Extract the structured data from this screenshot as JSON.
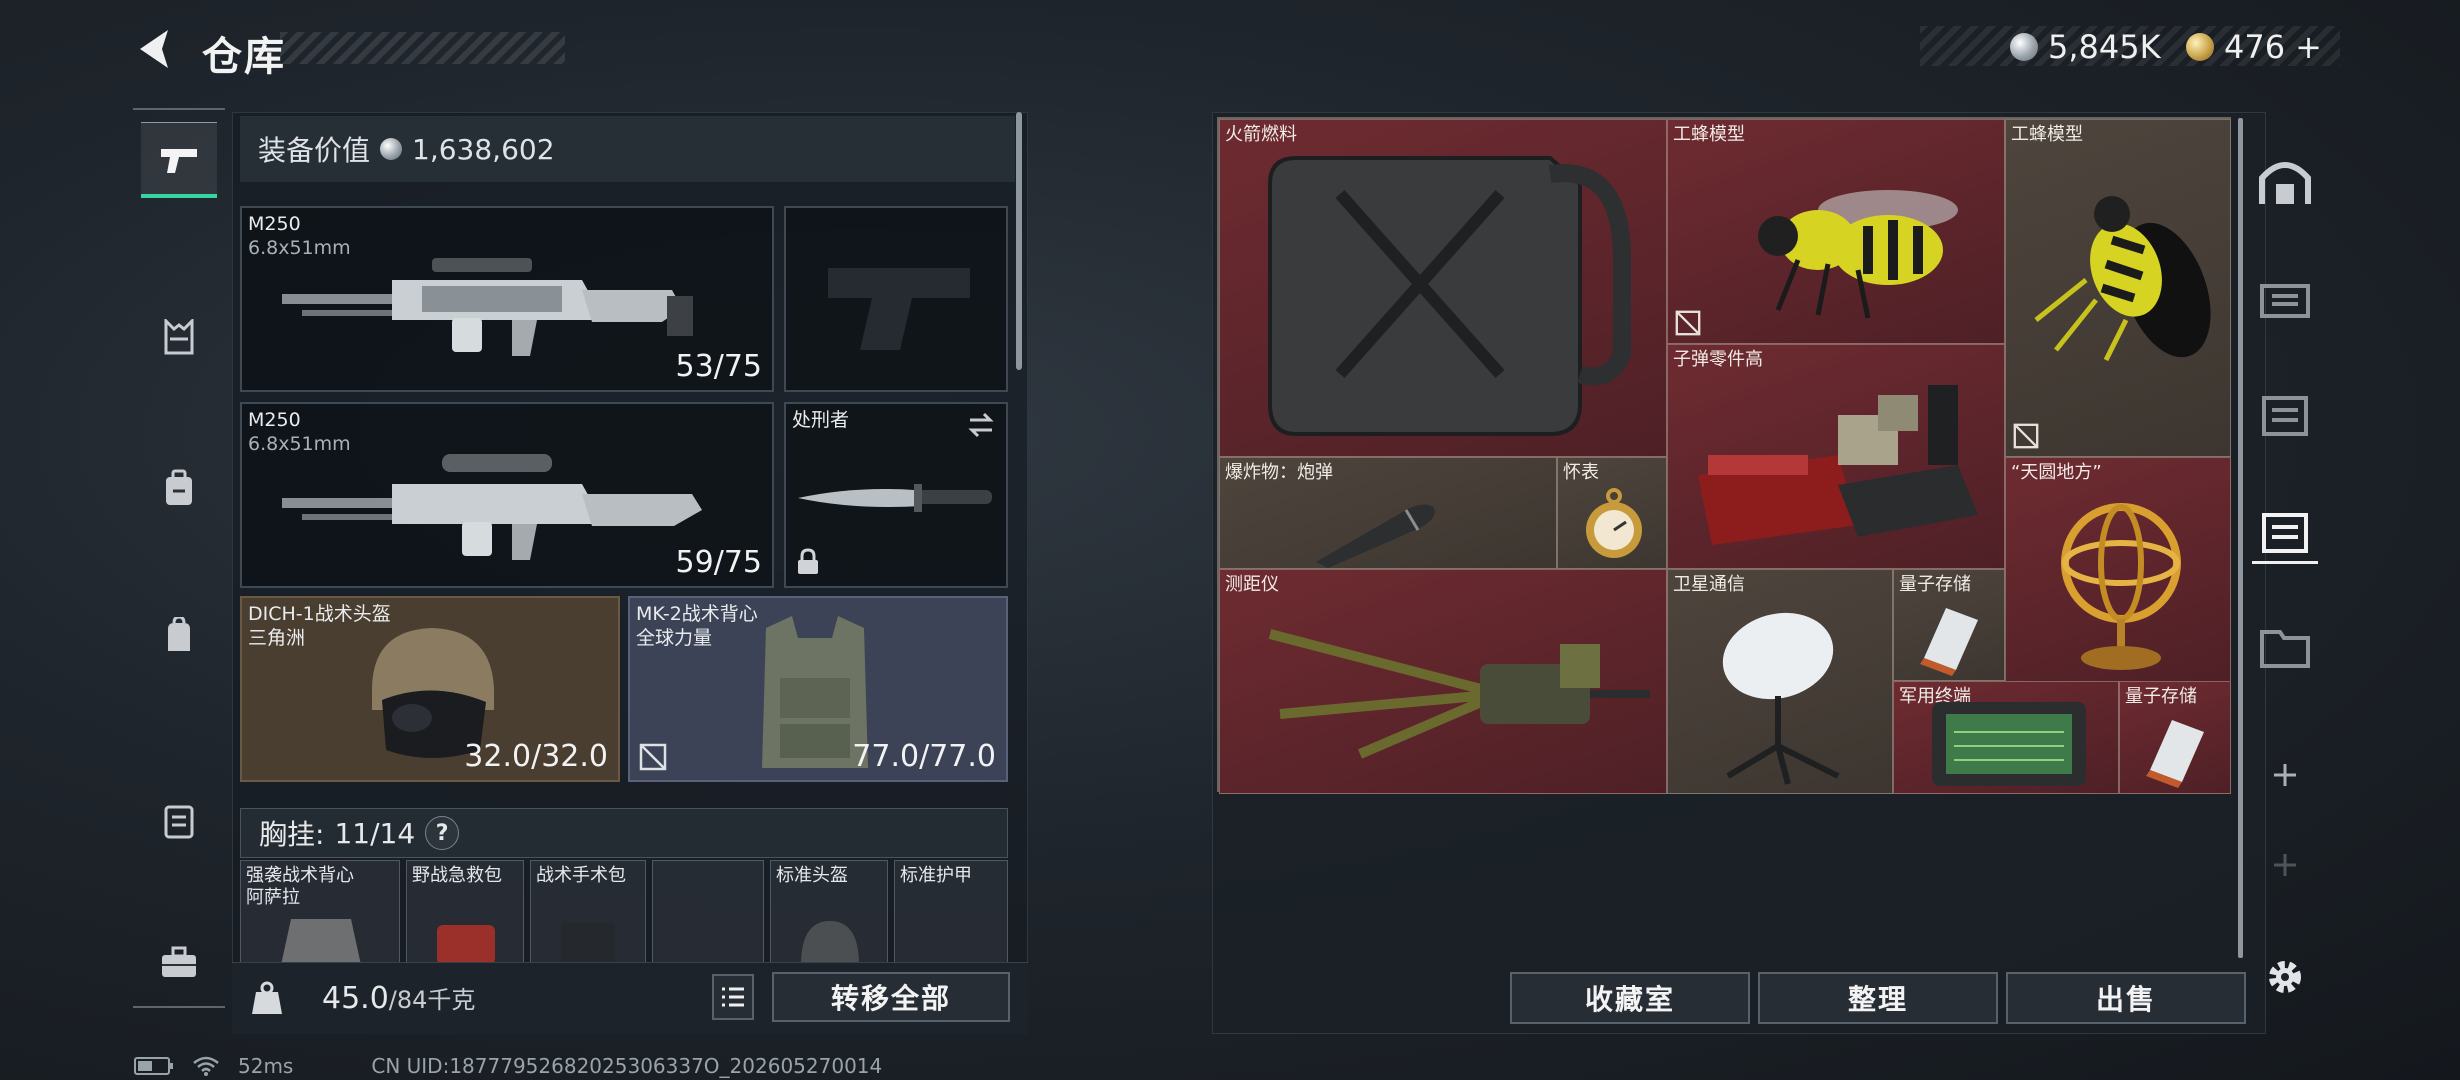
{
  "header": {
    "title": "仓库"
  },
  "currency": {
    "silver": "5,845K",
    "gold": "476",
    "gold_plus": "+"
  },
  "equipment": {
    "value_label": "装备价值",
    "value": "1,638,602",
    "primary1": {
      "name": "M250",
      "ammo": "6.8x51mm",
      "durability": "53/75"
    },
    "primary2": {
      "name": "M250",
      "ammo": "6.8x51mm",
      "durability": "59/75"
    },
    "melee": {
      "name": "处刑者"
    },
    "helmet": {
      "name": "DICH-1战术头盔",
      "faction": "三角洲",
      "durability": "32.0/32.0"
    },
    "armor": {
      "name": "MK-2战术背心",
      "faction": "全球力量",
      "durability": "77.0/77.0"
    },
    "chest": {
      "label": "胸挂:",
      "count": "11/14",
      "help": "?"
    },
    "mini_slots": [
      {
        "label": "强袭战术背心",
        "sub": "阿萨拉"
      },
      {
        "label": "野战急救包"
      },
      {
        "label": "战术手术包"
      },
      {
        "label": ""
      },
      {
        "label": "标准头盔"
      },
      {
        "label": "标准护甲"
      }
    ],
    "weight": {
      "current": "45.0",
      "max": "/84千克"
    },
    "transfer_all": "转移全部"
  },
  "storage_items": [
    {
      "label": "火箭燃料"
    },
    {
      "label": "工蜂模型"
    },
    {
      "label": "工蜂模型"
    },
    {
      "label": "子弹零件高"
    },
    {
      "label": "爆炸物：炮弹"
    },
    {
      "label": "怀表"
    },
    {
      "label": "“天圆地方”"
    },
    {
      "label": "测距仪"
    },
    {
      "label": "卫星通信"
    },
    {
      "label": "量子存储"
    },
    {
      "label": "军用终端"
    },
    {
      "label": "量子存储"
    }
  ],
  "actions": {
    "collection": "收藏室",
    "sort": "整理",
    "sell": "出售"
  },
  "status": {
    "ping": "52ms",
    "uid": "CN UID:18777952682025306337O_202605270014"
  },
  "colors": {
    "accent": "#37d5a0",
    "rare_red": "#6e2b31",
    "item_tan": "#4e453d"
  }
}
